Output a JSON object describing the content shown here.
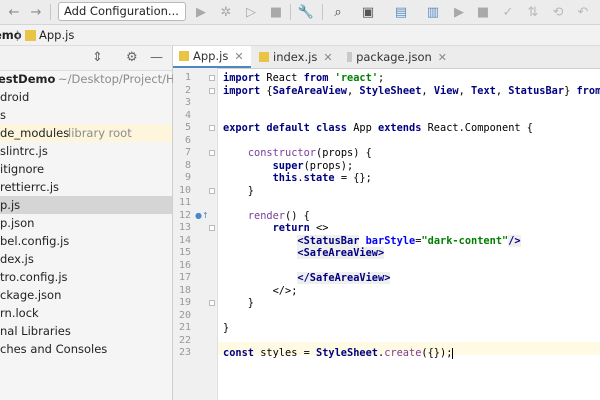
{
  "toolbar": {
    "config_label": "Add Configuration...",
    "icons": [
      "back-arrow-icon",
      "forward-arrow-icon",
      "run-icon",
      "debug-icon",
      "profile-icon",
      "stop-icon",
      "wrench-icon",
      "search-icon",
      "git-icon",
      "npm-icon",
      "device-icon",
      "run2-icon",
      "stop2-icon",
      "commit-icon",
      "update-icon",
      "history-icon"
    ]
  },
  "breadcrumb": {
    "project": "emo",
    "separator": "〉",
    "file": "App.js"
  },
  "project_panel": {
    "tree": [
      {
        "label": "estDemo",
        "hint": "~/Desktop/Project/Htt",
        "bold": true
      },
      {
        "label": "droid"
      },
      {
        "label": "s"
      },
      {
        "label": "de_modules",
        "hint": "library root",
        "excluded": true
      },
      {
        "label": "slintrc.js"
      },
      {
        "label": "itignore"
      },
      {
        "label": "rettierrc.js"
      },
      {
        "label": "p.js",
        "selected": true
      },
      {
        "label": "p.json"
      },
      {
        "label": "bel.config.js"
      },
      {
        "label": "dex.js"
      },
      {
        "label": "tro.config.js"
      },
      {
        "label": "ckage.json"
      },
      {
        "label": "rn.lock"
      },
      {
        "label": "nal Libraries"
      },
      {
        "label": "ches and Consoles"
      }
    ]
  },
  "tabs": [
    {
      "label": "App.js",
      "active": true
    },
    {
      "label": "index.js"
    },
    {
      "label": "package.json"
    }
  ],
  "code": {
    "line_numbers": [
      "1",
      "2",
      "3",
      "4",
      "5",
      "6",
      "7",
      "8",
      "9",
      "10",
      "11",
      "12",
      "13",
      "14",
      "15",
      "16",
      "17",
      "18",
      "19",
      "20",
      "21",
      "22",
      "23"
    ],
    "lines": [
      "import React from 'react';",
      "import {SafeAreaView, StyleSheet, View, Text, StatusBar} from 'rea",
      "",
      "",
      "export default class App extends React.Component {",
      "",
      "    constructor(props) {",
      "        super(props);",
      "        this.state = {};",
      "    }",
      "",
      "    render() {",
      "        return <>",
      "            <StatusBar barStyle=\"dark-content\"/>",
      "            <SafeAreaView>",
      "",
      "            </SafeAreaView>",
      "        </>;",
      "    }",
      "",
      "}",
      "",
      "const styles = StyleSheet.create({});"
    ]
  }
}
